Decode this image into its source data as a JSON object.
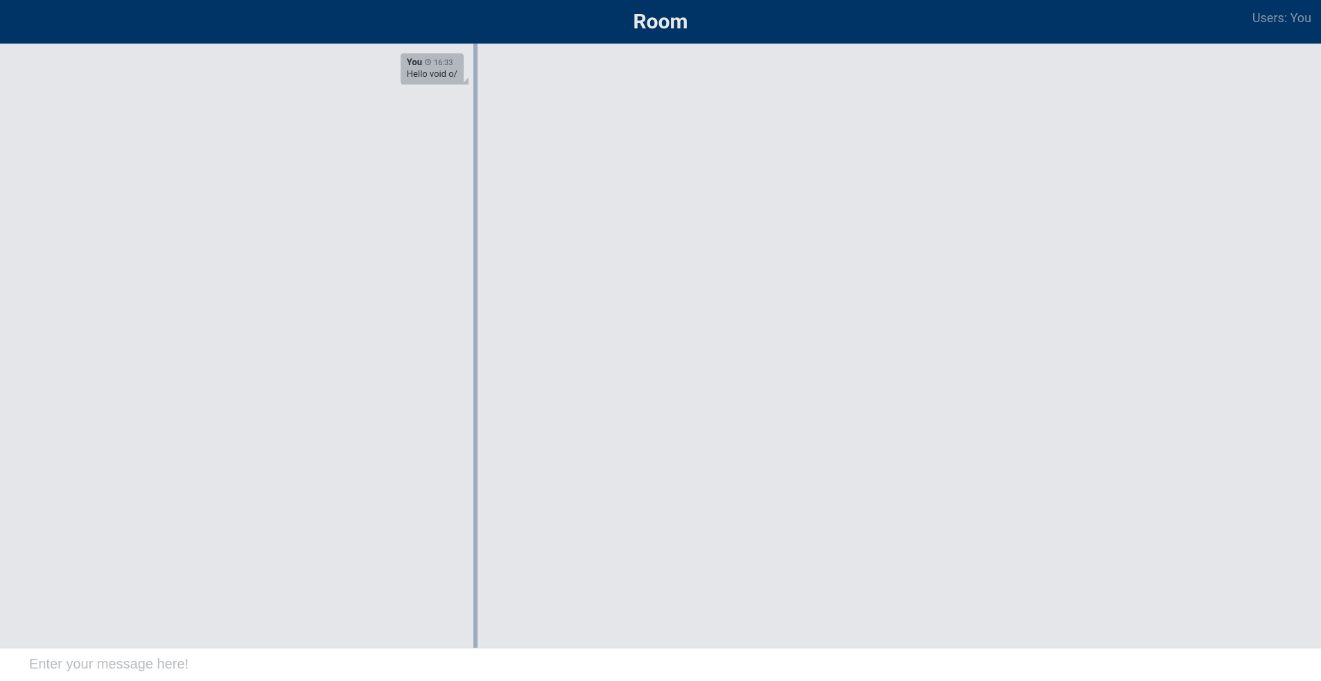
{
  "header": {
    "title": "Room",
    "users_label": "Users: You"
  },
  "messages": [
    {
      "sender": "You",
      "time": "16:33",
      "text": "Hello void o/"
    }
  ],
  "input": {
    "placeholder": "Enter your message here!",
    "value": ""
  }
}
